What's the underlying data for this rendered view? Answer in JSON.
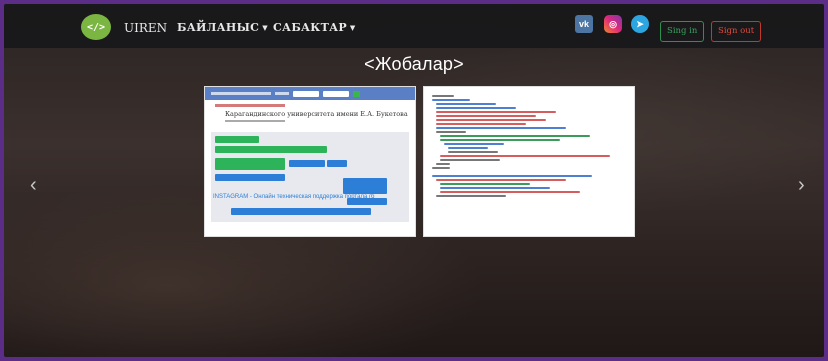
{
  "navbar": {
    "logo_glyph": "</>",
    "brand": "UIREN",
    "links": [
      {
        "label": "БАЙЛАНЫС",
        "has_caret": true
      },
      {
        "label": "САБАКТАР",
        "has_caret": true
      }
    ],
    "social": [
      {
        "icon": "vk-icon",
        "glyph": "vk",
        "color": "#4c75a3"
      },
      {
        "icon": "instagram-icon",
        "glyph": "◎",
        "color": "#dd2a7b"
      },
      {
        "icon": "telegram-icon",
        "glyph": "➤",
        "color": "#2ca5e0"
      }
    ],
    "sign_in": "Sing in",
    "sign_out": "Sign out"
  },
  "section": {
    "heading": "<Жобалар>"
  },
  "carousel": {
    "prev_glyph": "‹",
    "next_glyph": "›"
  },
  "cards": [
    {
      "type": "website-screenshot",
      "title_line": "Карагандинского университета имени Е.А. Букетова",
      "caption": "INSTAGRAM - Онлайн техническая поддержка портала (б"
    },
    {
      "type": "code-screenshot"
    }
  ],
  "colors": {
    "page_border": "#5c2d86",
    "navbar_bg": "#18181a",
    "logo_green": "#7bb542",
    "sign_in": "#3aa15d",
    "sign_out": "#e04a3c"
  }
}
